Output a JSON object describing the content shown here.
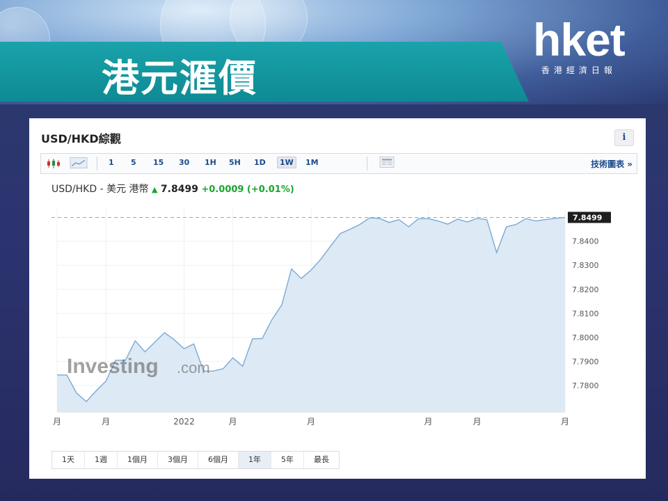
{
  "banner": {
    "title": "港元滙價"
  },
  "logo": {
    "main": "hket",
    "sub": "香港經濟日報"
  },
  "widget": {
    "title": "USD/HKD綜觀",
    "info_label": "i",
    "toolbar": {
      "intervals": [
        "1",
        "5",
        "15",
        "30",
        "1H",
        "5H",
        "1D",
        "1W",
        "1M"
      ],
      "active_interval": "1W",
      "tech_chart_link": "技術圖表 »"
    },
    "quote": {
      "pair": "USD/HKD - 美元 港幣",
      "direction_icon": "up-arrow-icon",
      "price": "7.8499",
      "change": "+0.0009",
      "change_pct": "(+0.01%)"
    },
    "watermark": {
      "brand": "Investing",
      "suffix": ".com"
    },
    "ranges": [
      "1天",
      "1週",
      "1個月",
      "3個月",
      "6個月",
      "1年",
      "5年",
      "最長"
    ],
    "active_range": "1年"
  },
  "colors": {
    "teal": "#1aa3ab",
    "up_green": "#1aa530",
    "link_blue": "#1c4b8c",
    "line": "#7aa9d6",
    "fill": "#dde9f4"
  },
  "chart_data": {
    "type": "area",
    "series": [
      {
        "values": [
          7.7844,
          7.7843,
          7.7768,
          7.7733,
          7.7778,
          7.7818,
          7.7905,
          7.7905,
          7.7986,
          7.794,
          7.798,
          7.802,
          7.799,
          7.7953,
          7.7973,
          7.786,
          7.786,
          7.787,
          7.7915,
          7.788,
          7.7994,
          7.7995,
          7.8074,
          7.8135,
          7.8285,
          7.8245,
          7.828,
          7.8325,
          7.838,
          7.8432,
          7.845,
          7.847,
          7.8497,
          7.8495,
          7.8478,
          7.849,
          7.846,
          7.8494,
          7.8494,
          7.8484,
          7.8471,
          7.8492,
          7.848,
          7.8495,
          7.849,
          7.8353,
          7.846,
          7.847,
          7.8494,
          7.8484,
          7.849,
          7.8495,
          7.8499
        ]
      }
    ],
    "current_value": 7.8499,
    "current_label": "7.8499",
    "y_ticks": [
      "7.8400",
      "7.8300",
      "7.8200",
      "7.8100",
      "7.8000",
      "7.7900",
      "7.7800"
    ],
    "y_tick_values": [
      7.84,
      7.83,
      7.82,
      7.81,
      7.8,
      7.79,
      7.78
    ],
    "x_labels": [
      "月",
      "月",
      "2022",
      "月",
      "月",
      "月",
      "月",
      "月"
    ],
    "x_label_index": [
      0,
      5,
      13,
      18,
      26,
      38,
      43,
      52
    ],
    "ylim": [
      7.769,
      7.8535
    ],
    "grid": true
  }
}
